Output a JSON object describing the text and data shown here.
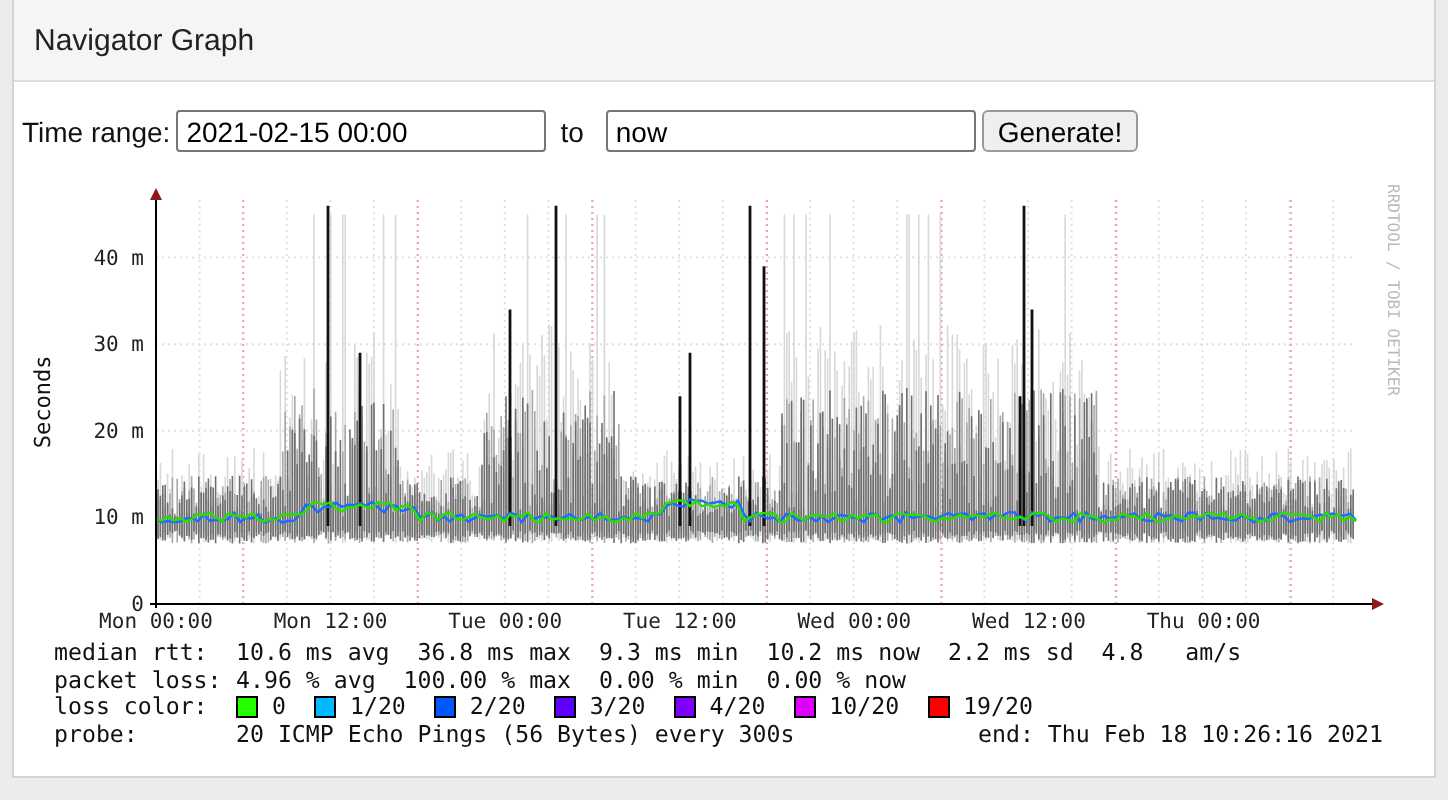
{
  "panel": {
    "title": "Navigator Graph"
  },
  "form": {
    "label": "Time range:",
    "from": "2021-02-15 00:00",
    "separator": "to",
    "to": "now",
    "button": "Generate!"
  },
  "graph": {
    "ylabel": "Seconds",
    "side_label": "RRDTOOL / TOBI OETIKER",
    "yticks": [
      "40 m",
      "30 m",
      "20 m",
      "10 m",
      "0"
    ],
    "xticks": [
      "Mon 00:00",
      "Mon 12:00",
      "Tue 00:00",
      "Tue 12:00",
      "Wed 00:00",
      "Wed 12:00",
      "Thu 00:00"
    ]
  },
  "legend": {
    "rows": [
      {
        "label": "median rtt:",
        "value": "10.6 ms avg  36.8 ms max  9.3 ms min  10.2 ms now  2.2 ms sd  4.8   am/s"
      },
      {
        "label": "packet loss:",
        "value": "4.96 % avg  100.00 % max  0.00 % min  0.00 % now"
      }
    ],
    "loss_label": "loss color:",
    "loss_colors": [
      {
        "label": "0",
        "color": "#26ff00"
      },
      {
        "label": "1/20",
        "color": "#00b8ff"
      },
      {
        "label": "2/20",
        "color": "#0059ff"
      },
      {
        "label": "3/20",
        "color": "#5e00ff"
      },
      {
        "label": "4/20",
        "color": "#7e00ff"
      },
      {
        "label": "10/20",
        "color": "#dd00ff"
      },
      {
        "label": "19/20",
        "color": "#ff0000"
      }
    ],
    "probe_label": "probe:",
    "probe": "20 ICMP Echo Pings (56 Bytes) every 300s",
    "end": "end: Thu Feb 18 10:26:16 2021"
  }
}
